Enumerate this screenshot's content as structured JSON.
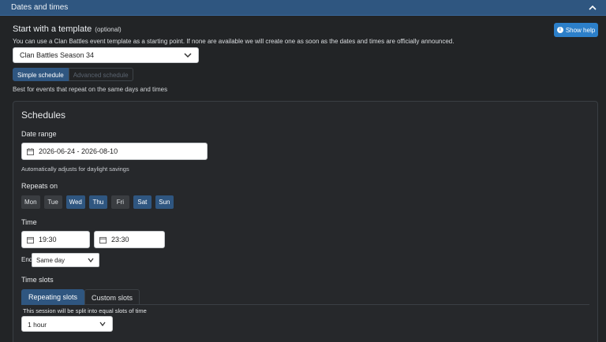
{
  "header": {
    "title": "Dates and times"
  },
  "template": {
    "title": "Start with a template",
    "optional": "(optional)",
    "help_button": "Show help",
    "description": "You can use a Clan Battles event template as a starting point. If none are available we will create one as soon as the dates and times are officially announced.",
    "selected": "Clan Battles Season 34"
  },
  "schedule_mode": {
    "simple": "Simple schedule",
    "advanced": "Advanced schedule",
    "hint": "Best for events that repeat on the same days and times"
  },
  "schedules": {
    "title": "Schedules",
    "date_range_label": "Date range",
    "date_range_value": "2026-06-24 - 2026-08-10",
    "date_note": "Automatically adjusts for daylight savings",
    "repeats_label": "Repeats on",
    "days": [
      {
        "label": "Mon",
        "on": false
      },
      {
        "label": "Tue",
        "on": false
      },
      {
        "label": "Wed",
        "on": true
      },
      {
        "label": "Thu",
        "on": true
      },
      {
        "label": "Fri",
        "on": false
      },
      {
        "label": "Sat",
        "on": true
      },
      {
        "label": "Sun",
        "on": true
      }
    ],
    "time_label": "Time",
    "start_time": "19:30",
    "end_time": "23:30",
    "ends_label": "Ends",
    "ends_value": "Same day",
    "time_slots_label": "Time slots",
    "tabs": [
      "Repeating slots",
      "Custom slots"
    ],
    "split_note": "This session will be split into equal slots of time",
    "slot_value": "1 hour"
  },
  "colors": {
    "accent": "#2f5680",
    "help": "#2c7fc9",
    "background": "#222426"
  }
}
